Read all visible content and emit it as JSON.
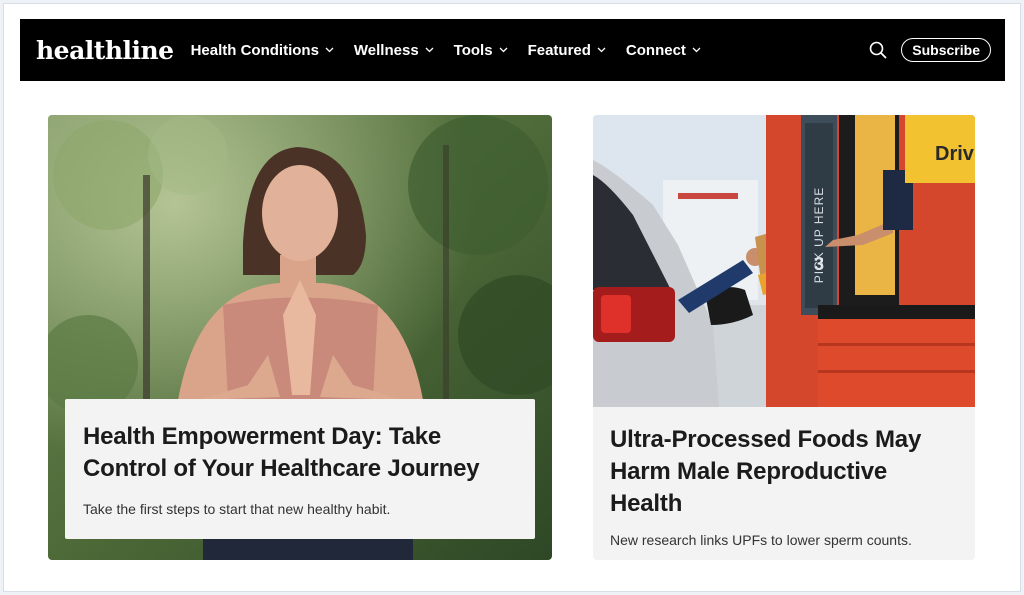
{
  "brand": {
    "logo_text": "healthline"
  },
  "nav": {
    "items": [
      {
        "label": "Health Conditions"
      },
      {
        "label": "Wellness"
      },
      {
        "label": "Tools"
      },
      {
        "label": "Featured"
      },
      {
        "label": "Connect"
      }
    ],
    "subscribe_label": "Subscribe"
  },
  "icons": {
    "search": "search-icon",
    "dropdown": "chevron-down-icon"
  },
  "colors": {
    "nav_bg": "#000000",
    "card_bg": "#f3f3f3",
    "headline": "#1b1b1b"
  },
  "articles": [
    {
      "headline": "Health Empowerment Day: Take Control of Your Healthcare Journey",
      "dek": "Take the first steps to start that new healthy habit."
    },
    {
      "headline": "Ultra-Processed Foods May Harm Male Reproductive Health",
      "dek": "New research links UPFs to lower sperm counts.",
      "image_signage": "PICK UP HERE",
      "image_number": "3",
      "image_sign_text": "Driv"
    }
  ]
}
